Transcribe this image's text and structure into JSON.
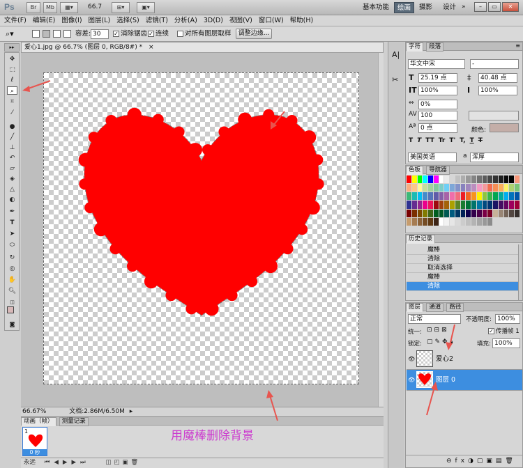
{
  "app": {
    "logo": "Ps",
    "zoom": "66.7",
    "workspaces": [
      "基本功能",
      "绘画",
      "摄影",
      "设计"
    ],
    "active_workspace": "绘画"
  },
  "menu": [
    "文件(F)",
    "编辑(E)",
    "图像(I)",
    "图层(L)",
    "选择(S)",
    "滤镜(T)",
    "分析(A)",
    "3D(D)",
    "视图(V)",
    "窗口(W)",
    "帮助(H)"
  ],
  "options": {
    "tolerance_label": "容差:",
    "tolerance_value": "30",
    "antialias": "消除锯齿",
    "contiguous": "连续",
    "sample_all": "对所有图层取样",
    "refine_button": "调整边缘..."
  },
  "document": {
    "tab_title": "爱心1.jpg @ 66.7% (图层 0, RGB/8#) *",
    "zoom": "66.67%",
    "doc_size": "文档:2.86M/6.50M"
  },
  "animation": {
    "tabs": [
      "动画（帧）",
      "测量记录"
    ],
    "frame_number": "1",
    "frame_delay": "0 秒",
    "loop": "永远",
    "caption": "用魔棒删除背景"
  },
  "character": {
    "tabs": [
      "字符",
      "段落"
    ],
    "font_family": "华文中宋",
    "font_style": "-",
    "size": "25.19 点",
    "leading": "40.48 点",
    "vscale": "100%",
    "hscale": "100%",
    "tracking": "0%",
    "kerning": "100",
    "baseline": "0 点",
    "color_label": "颜色:",
    "language": "美国英语",
    "antialias": "浑厚",
    "aa_label": "a",
    "style_buttons": [
      "T",
      "T",
      "TT",
      "Tr",
      "T'",
      "T,",
      "T",
      "T"
    ]
  },
  "swatches": {
    "tabs": [
      "色板",
      "导航器"
    ],
    "colors": [
      "#ff0000",
      "#ffff00",
      "#00ff00",
      "#00ffff",
      "#0000ff",
      "#ff00ff",
      "#ffffff",
      "#ebebeb",
      "#d6d6d6",
      "#c2c2c2",
      "#adadad",
      "#999999",
      "#858585",
      "#707070",
      "#5c5c5c",
      "#474747",
      "#333333",
      "#1f1f1f",
      "#0a0a0a",
      "#000000",
      "#f7977a",
      "#f9ad81",
      "#fdc68a",
      "#fff79a",
      "#c4df9b",
      "#a2d39c",
      "#82ca9d",
      "#7bcdc8",
      "#6ecff6",
      "#7ea7d8",
      "#8493ca",
      "#8882be",
      "#a187be",
      "#bc8dbf",
      "#f49ac2",
      "#f6989d",
      "#f26c4f",
      "#f68e55",
      "#fbaf5c",
      "#fff467",
      "#acd372",
      "#7cc576",
      "#3bb878",
      "#1abbb4",
      "#00bff3",
      "#438ccb",
      "#5574b9",
      "#605ca8",
      "#855fa8",
      "#a763a8",
      "#f06eaa",
      "#f26d7d",
      "#ed1c24",
      "#f26522",
      "#f7941d",
      "#fff200",
      "#8dc63f",
      "#39b54a",
      "#00a651",
      "#00a99d",
      "#00aeef",
      "#0072bc",
      "#0054a6",
      "#2e3192",
      "#662d91",
      "#92278f",
      "#ec008c",
      "#ed145b",
      "#9e0b0f",
      "#a0410d",
      "#a36209",
      "#aba000",
      "#598527",
      "#197b30",
      "#007236",
      "#00746b",
      "#0076a3",
      "#004a80",
      "#003471",
      "#1b1464",
      "#440e62",
      "#630460",
      "#9e005d",
      "#9e0039",
      "#790000",
      "#7b2e00",
      "#7d4900",
      "#827b00",
      "#406618",
      "#005e20",
      "#005826",
      "#005952",
      "#005b7f",
      "#003663",
      "#002157",
      "#0d004c",
      "#32004b",
      "#4b0049",
      "#7b0046",
      "#7a0026",
      "#c7b299",
      "#998675",
      "#736357",
      "#534741",
      "#37302d",
      "#c69c6d",
      "#a67c52",
      "#8c6239",
      "#754c24",
      "#603913",
      "#3c2415",
      "#ffffff",
      "#f2f2f2",
      "#e6e6e6",
      "#d9d9d9",
      "#cccccc",
      "#bfbfbf",
      "#b3b3b3",
      "#a6a6a6",
      "#999999",
      "#8c8c8c"
    ]
  },
  "history": {
    "tabs": [
      "历史记录"
    ],
    "items": [
      "魔棒",
      "清除",
      "取消选择",
      "魔棒",
      "清除"
    ]
  },
  "layers": {
    "tabs": [
      "图层",
      "通道",
      "路径"
    ],
    "blend_mode": "正常",
    "opacity_label": "不透明度:",
    "opacity": "100%",
    "unify_label": "统一:",
    "propagate_label": "传播帧 1",
    "lock_label": "锁定:",
    "fill_label": "填充:",
    "fill": "100%",
    "items": [
      {
        "name": "爱心2",
        "selected": false
      },
      {
        "name": "图层 0",
        "selected": true
      }
    ]
  },
  "tools": [
    "move",
    "marquee",
    "lasso",
    "magic-wand",
    "crop",
    "eyedropper",
    "healing",
    "brush",
    "stamp",
    "history-brush",
    "eraser",
    "gradient",
    "blur",
    "dodge",
    "pen",
    "type",
    "path-select",
    "shape",
    "3d-rotate",
    "3d-orbit",
    "hand",
    "zoom"
  ],
  "colors": {
    "foreground": "#d7b8b8",
    "background": "#000000",
    "heart": "#ff0000",
    "selection_bg": "#3d8ee0"
  }
}
